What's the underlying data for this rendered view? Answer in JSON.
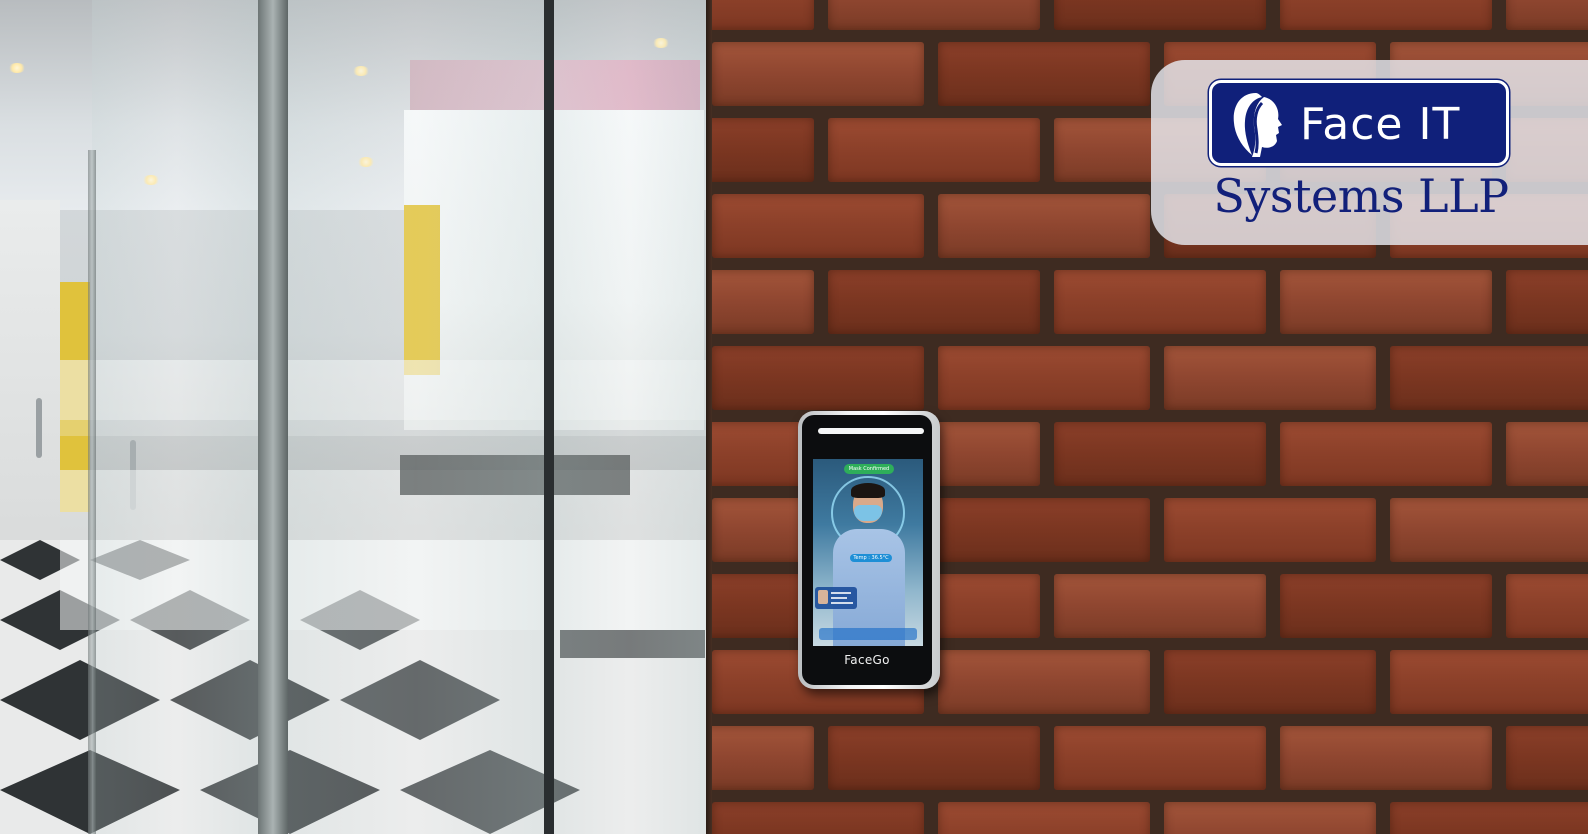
{
  "logo": {
    "wordmark": "Face IT",
    "subtitle": "Systems LLP",
    "icon": "face-profile-icon",
    "badge_color": "#10207a",
    "text_color": "#12207a"
  },
  "device": {
    "brand": "FaceGo",
    "screen_status": "Mask Confirmed",
    "temperature_label": "Temp : 36.5°C"
  },
  "colors": {
    "brick": "#8d412a",
    "mortar": "#3e2b21"
  }
}
